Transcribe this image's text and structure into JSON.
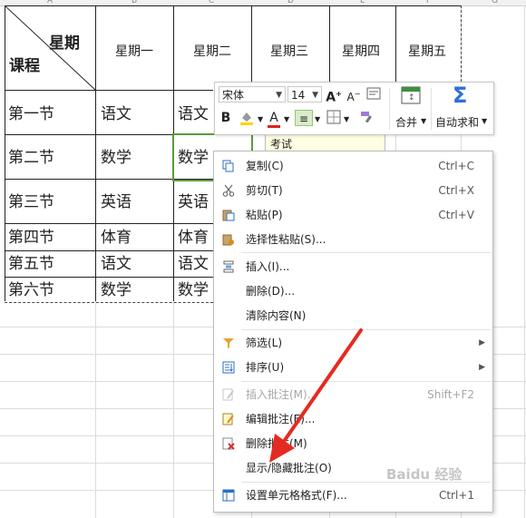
{
  "columns": [
    "A",
    "B",
    "C",
    "D",
    "E",
    "F",
    "G"
  ],
  "header": {
    "diag_top": "星期",
    "diag_bottom": "课程",
    "days": [
      "星期一",
      "星期二",
      "星期三",
      "星期四",
      "星期五"
    ]
  },
  "rows": [
    {
      "label": "第一节",
      "mon": "语文",
      "tue": "语文"
    },
    {
      "label": "第二节",
      "mon": "数学",
      "tue": "数学"
    },
    {
      "label": "第三节",
      "mon": "英语",
      "tue": "英语"
    },
    {
      "label": "第四节",
      "mon": "体育",
      "tue": "体育"
    },
    {
      "label": "第五节",
      "mon": "语文",
      "tue": "语文"
    },
    {
      "label": "第六节",
      "mon": "数学",
      "tue": "数学"
    }
  ],
  "comment": {
    "text": "考试"
  },
  "mini_toolbar": {
    "font": "宋体",
    "size": "14",
    "merge": "合并",
    "autosum": "自动求和"
  },
  "menu": [
    {
      "label": "复制(C)",
      "shortcut": "Ctrl+C",
      "icon": "copy-icon"
    },
    {
      "label": "剪切(T)",
      "shortcut": "Ctrl+X",
      "icon": "scissors-icon"
    },
    {
      "label": "粘贴(P)",
      "shortcut": "Ctrl+V",
      "icon": "paste-icon"
    },
    {
      "label": "选择性粘贴(S)...",
      "shortcut": "",
      "icon": "paste-special-icon"
    },
    {
      "label": "插入(I)...",
      "shortcut": "",
      "icon": "insert-icon"
    },
    {
      "label": "删除(D)...",
      "shortcut": "",
      "icon": ""
    },
    {
      "label": "清除内容(N)",
      "shortcut": "",
      "icon": ""
    },
    {
      "label": "筛选(L)",
      "shortcut": "",
      "icon": "filter-icon"
    },
    {
      "label": "排序(U)",
      "shortcut": "",
      "icon": "sort-icon"
    },
    {
      "label": "插入批注(M)...",
      "shortcut": "Shift+F2",
      "icon": "insert-comment-icon"
    },
    {
      "label": "编辑批注(E)...",
      "shortcut": "",
      "icon": "edit-comment-icon"
    },
    {
      "label": "删除批注(M)",
      "shortcut": "",
      "icon": "delete-comment-icon"
    },
    {
      "label": "显示/隐藏批注(O)",
      "shortcut": "",
      "icon": ""
    },
    {
      "label": "设置单元格格式(F)...",
      "shortcut": "Ctrl+1",
      "icon": "format-cells-icon"
    }
  ],
  "colors": {
    "selection": "#5b9a3c",
    "font_red": "#e02020",
    "highlight_yellow": "#ffd400",
    "arrow_red": "#e42b22",
    "sigma_blue": "#2f6fd6"
  },
  "watermark": "Baidu 经验"
}
